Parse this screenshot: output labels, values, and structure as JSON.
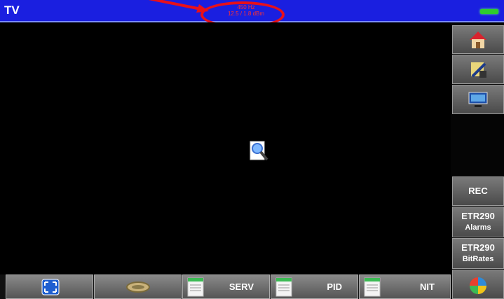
{
  "header": {
    "title": "TV",
    "center_line1": "450 Hz",
    "center_line2": "12.5 / 1.8 dBm"
  },
  "side_menu": {
    "rec_label": "REC",
    "etr_alarms_line1": "ETR290",
    "etr_alarms_line2": "Alarms",
    "etr_bitrates_line1": "ETR290",
    "etr_bitrates_line2": "BitRates"
  },
  "bottom_menu": {
    "serv_label": "SERV",
    "pid_label": "PID",
    "nit_label": "NIT"
  },
  "colors": {
    "header_bg": "#1a1fe0",
    "annotation": "#e8101a",
    "signal": "#2ecc2e"
  }
}
